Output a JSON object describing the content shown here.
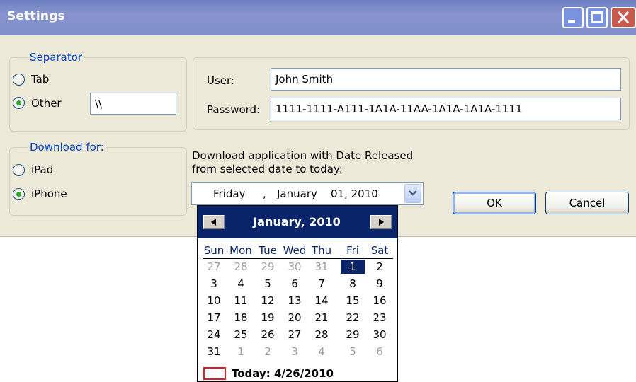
{
  "window": {
    "title": "Settings"
  },
  "separator": {
    "legend": "Separator",
    "options": [
      {
        "label": "Tab",
        "checked": false
      },
      {
        "label": "Other",
        "checked": true
      }
    ],
    "other_value": "\\\\"
  },
  "credentials": {
    "user_label": "User:",
    "user_value": "John Smith",
    "password_label": "Password:",
    "password_value": "1111-1111-A111-1A1A-11AA-1A1A-1A1A-1111"
  },
  "download_for": {
    "legend": "Download for:",
    "options": [
      {
        "label": "iPad",
        "checked": false
      },
      {
        "label": "iPhone",
        "checked": true
      }
    ]
  },
  "date_section": {
    "description_line1": "Download application with Date Released",
    "description_line2": "from selected date to today:",
    "picker_weekday": "Friday",
    "picker_separator": ",",
    "picker_month": "January",
    "picker_day": "01, 2010"
  },
  "buttons": {
    "ok": "OK",
    "cancel": "Cancel"
  },
  "calendar": {
    "month_title": "January, 2010",
    "weekdays": [
      "Sun",
      "Mon",
      "Tue",
      "Wed",
      "Thu",
      "Fri",
      "Sat"
    ],
    "weeks": [
      [
        "27",
        "28",
        "29",
        "30",
        "31",
        "1",
        "2"
      ],
      [
        "3",
        "4",
        "5",
        "6",
        "7",
        "8",
        "9"
      ],
      [
        "10",
        "11",
        "12",
        "13",
        "14",
        "15",
        "16"
      ],
      [
        "17",
        "18",
        "19",
        "20",
        "21",
        "22",
        "23"
      ],
      [
        "24",
        "25",
        "26",
        "27",
        "28",
        "29",
        "30"
      ],
      [
        "31",
        "1",
        "2",
        "3",
        "4",
        "5",
        "6"
      ]
    ],
    "today_text": "Today: 4/26/2010"
  },
  "colors": {
    "titlebar": "#7f8dca",
    "legend_text": "#0046d5",
    "calendar_header": "#0a246a",
    "today_marker": "#e02020",
    "radio_dot": "#2fa42f"
  },
  "icons": [
    "minimize-icon",
    "maximize-icon",
    "close-icon",
    "chevron-down-icon",
    "chevron-left-icon",
    "chevron-right-icon"
  ]
}
